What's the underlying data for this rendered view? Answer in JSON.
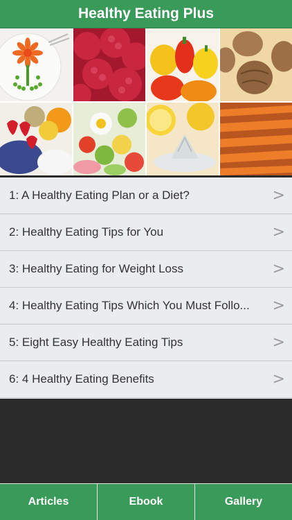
{
  "header": {
    "title": "Healthy Eating Plus"
  },
  "gallery": {
    "tiles": [
      "flower-plate-image",
      "raspberries-image",
      "peppers-image",
      "walnuts-image",
      "berries-fruit-image",
      "salad-image",
      "lemon-juicer-image",
      "carrots-image"
    ]
  },
  "articles": [
    {
      "label": "1: A Healthy Eating Plan or a Diet?"
    },
    {
      "label": "2: Healthy Eating Tips for You"
    },
    {
      "label": "3: Healthy Eating for Weight Loss"
    },
    {
      "label": "4: Healthy Eating Tips Which You Must Follo..."
    },
    {
      "label": "5: Eight Easy Healthy Eating Tips"
    },
    {
      "label": "6: 4 Healthy Eating Benefits"
    }
  ],
  "chevron": ">",
  "tabs": [
    {
      "label": "Articles"
    },
    {
      "label": "Ebook"
    },
    {
      "label": "Gallery"
    }
  ],
  "colors": {
    "brand_green": "#3a9a5a",
    "background": "#2b2b2b",
    "list_bg": "#ebecef"
  }
}
